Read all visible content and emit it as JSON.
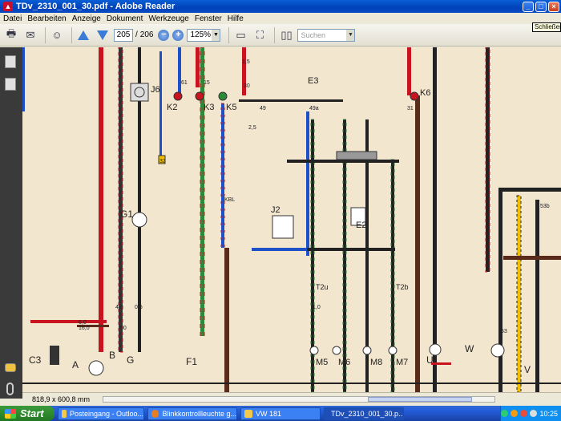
{
  "window": {
    "title": "TDv_2310_001_30.pdf - Adobe Reader",
    "close_tooltip": "Schließen"
  },
  "menu": [
    "Datei",
    "Bearbeiten",
    "Anzeige",
    "Dokument",
    "Werkzeuge",
    "Fenster",
    "Hilfe"
  ],
  "toolbar": {
    "page_current": "205",
    "page_separator": "/",
    "page_total": "206",
    "zoom": "125%",
    "search_placeholder": "Suchen"
  },
  "status": {
    "page_size": "818,9 x 600,8 mm"
  },
  "diagram_labels": {
    "j6": "J6",
    "k2": "K2",
    "k3": "K3",
    "k5": "K5",
    "k6": "K6",
    "e3": "E3",
    "e2": "E2",
    "j2": "J2",
    "g1": "G1",
    "g": "G",
    "c3": "C3",
    "a": "A",
    "b": "B",
    "f1": "F1",
    "u": "U",
    "w": "W",
    "v": "V",
    "t2u": "T2u",
    "t2b": "T2b",
    "m5": "M5",
    "m6": "M6",
    "m8": "M8",
    "m7": "M7",
    "n61": "61",
    "n15": "15",
    "n30": "30",
    "n31": "31",
    "n49": "49",
    "n49a": "49a",
    "kbl": "KBL",
    "n32": "32",
    "n50": "50",
    "n53": "53",
    "n53b": "53b",
    "n6": "6,0",
    "n16": "16,0",
    "n40": "4,0",
    "n05": "0,5",
    "n10": "1,0",
    "n25": "2,5",
    "n15b": "1,5"
  },
  "taskbar": {
    "start": "Start",
    "tasks": [
      "Posteingang - Outloo...",
      "Blinkkontrollleuchte g...",
      "VW 181",
      "TDv_2310_001_30.p..."
    ],
    "clock": "10:25"
  },
  "colors": {
    "accent": "#0a5fd6",
    "paper": "#f3e6cf",
    "wire_red": "#c8141e",
    "wire_blue": "#1e50c8",
    "wire_brown": "#5a2a1a"
  }
}
